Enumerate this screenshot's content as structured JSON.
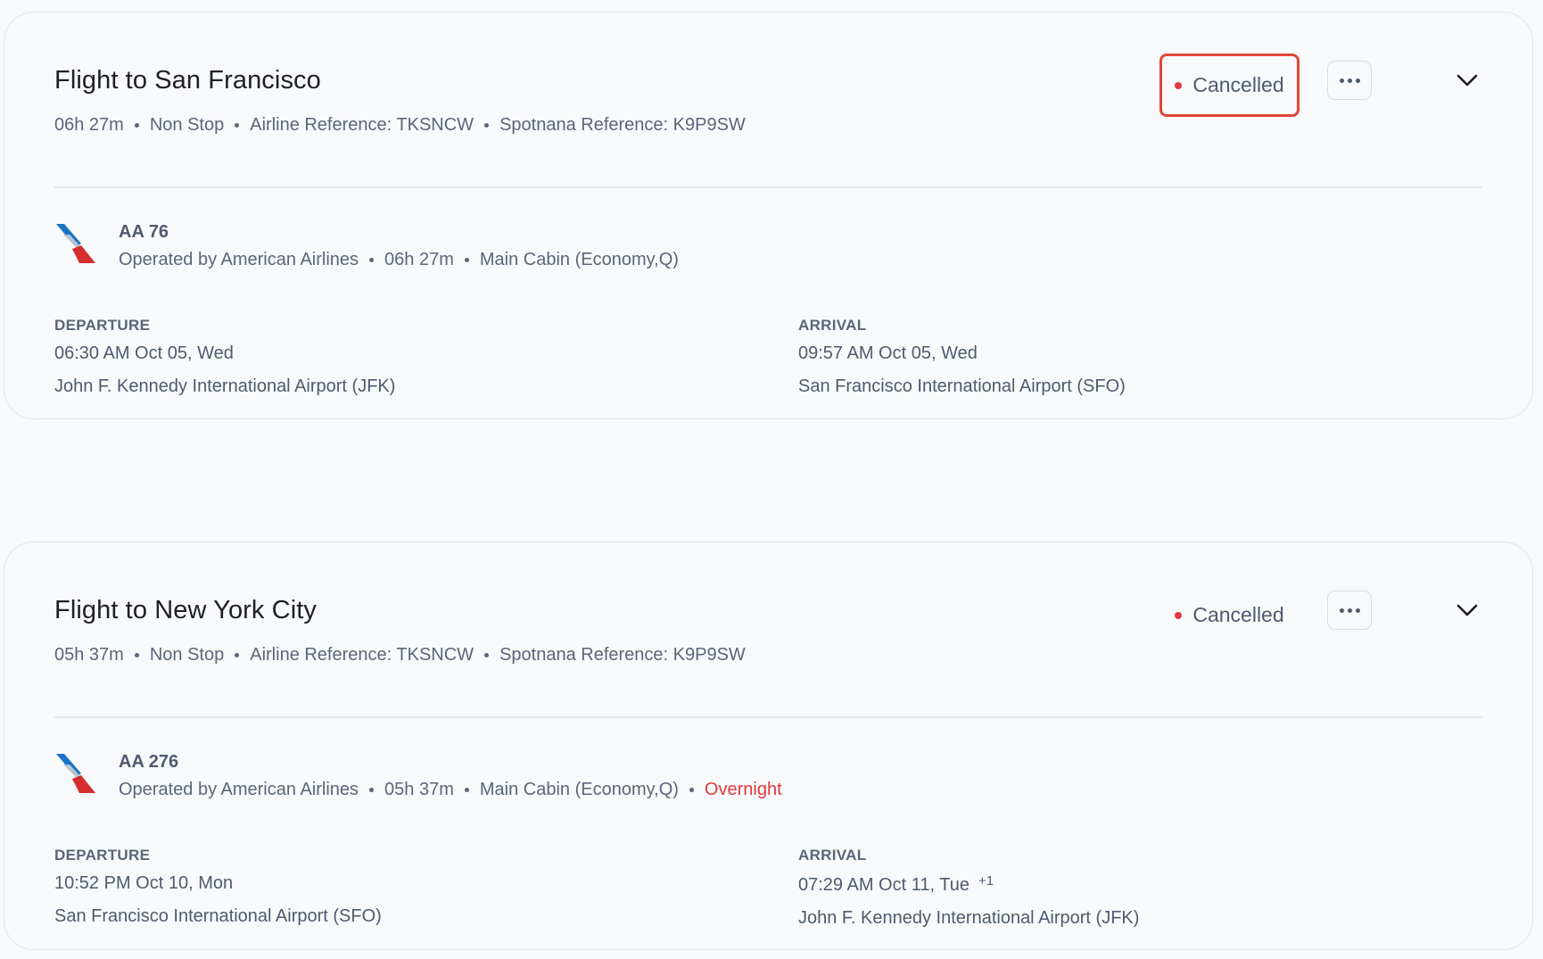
{
  "flights": [
    {
      "title": "Flight to San Francisco",
      "duration": "06h 27m",
      "stops": "Non Stop",
      "airline_reference": "Airline Reference: TKSNCW",
      "spotnana_reference": "Spotnana Reference: K9P9SW",
      "status": "Cancelled",
      "segment": {
        "flight_number": "AA 76",
        "operated_by": "Operated by American Airlines",
        "duration": "06h 27m",
        "cabin": "Main Cabin (Economy,Q)",
        "overnight": "",
        "departure_label": "DEPARTURE",
        "departure_time": "06:30 AM Oct 05, Wed",
        "departure_airport": "John F. Kennedy International Airport (JFK)",
        "arrival_label": "ARRIVAL",
        "arrival_time": "09:57 AM Oct 05, Wed",
        "arrival_day_offset": "",
        "arrival_airport": "San Francisco International Airport (SFO)"
      }
    },
    {
      "title": "Flight to New York City",
      "duration": "05h 37m",
      "stops": "Non Stop",
      "airline_reference": "Airline Reference: TKSNCW",
      "spotnana_reference": "Spotnana Reference: K9P9SW",
      "status": "Cancelled",
      "segment": {
        "flight_number": "AA 276",
        "operated_by": "Operated by American Airlines",
        "duration": "05h 37m",
        "cabin": "Main Cabin (Economy,Q)",
        "overnight": "Overnight",
        "departure_label": "DEPARTURE",
        "departure_time": "10:52 PM Oct 10, Mon",
        "departure_airport": "San Francisco International Airport (SFO)",
        "arrival_label": "ARRIVAL",
        "arrival_time": "07:29 AM Oct 11, Tue",
        "arrival_day_offset": "+1",
        "arrival_airport": "John F. Kennedy International Airport (JFK)"
      }
    }
  ],
  "icons": {
    "airline_logo": "american-airlines-logo-icon",
    "more": "more-horizontal-icon",
    "expand": "chevron-down-icon"
  },
  "colors": {
    "status_dot": "#e0393e",
    "highlight_border": "#e0483a",
    "overnight": "#e0393e"
  }
}
